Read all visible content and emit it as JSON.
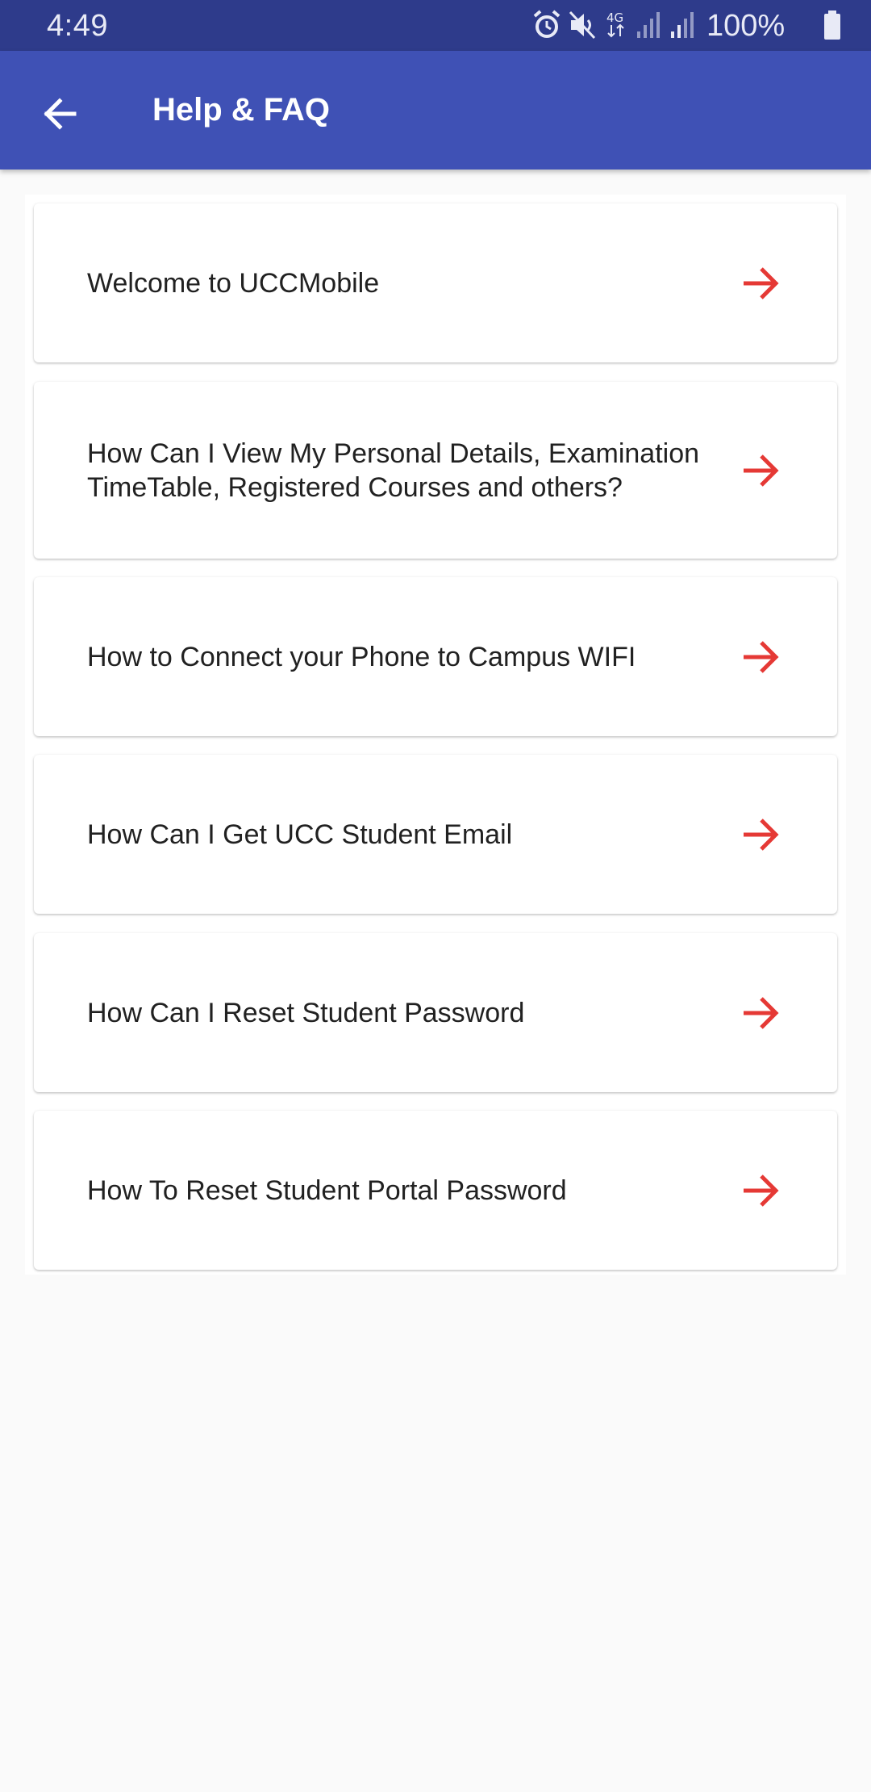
{
  "status_bar": {
    "time": "4:49",
    "battery": "100%",
    "icons": [
      "alarm-icon",
      "mute-icon",
      "4g-data-icon",
      "signal-icon",
      "signal-icon",
      "battery-icon"
    ]
  },
  "app_bar": {
    "title": "Help & FAQ",
    "back_icon": "arrow-back-icon",
    "background": "#3f51b5"
  },
  "faq": {
    "arrow_color": "#e53935",
    "items": [
      {
        "label": "Welcome to UCCMobile"
      },
      {
        "label": "How Can I View My Personal Details, Examination TimeTable, Registered Courses and others?"
      },
      {
        "label": "How to Connect your Phone to Campus WIFI"
      },
      {
        "label": "How Can I Get UCC Student Email"
      },
      {
        "label": "How Can I Reset Student Password"
      },
      {
        "label": "How To Reset Student Portal Password"
      }
    ]
  }
}
